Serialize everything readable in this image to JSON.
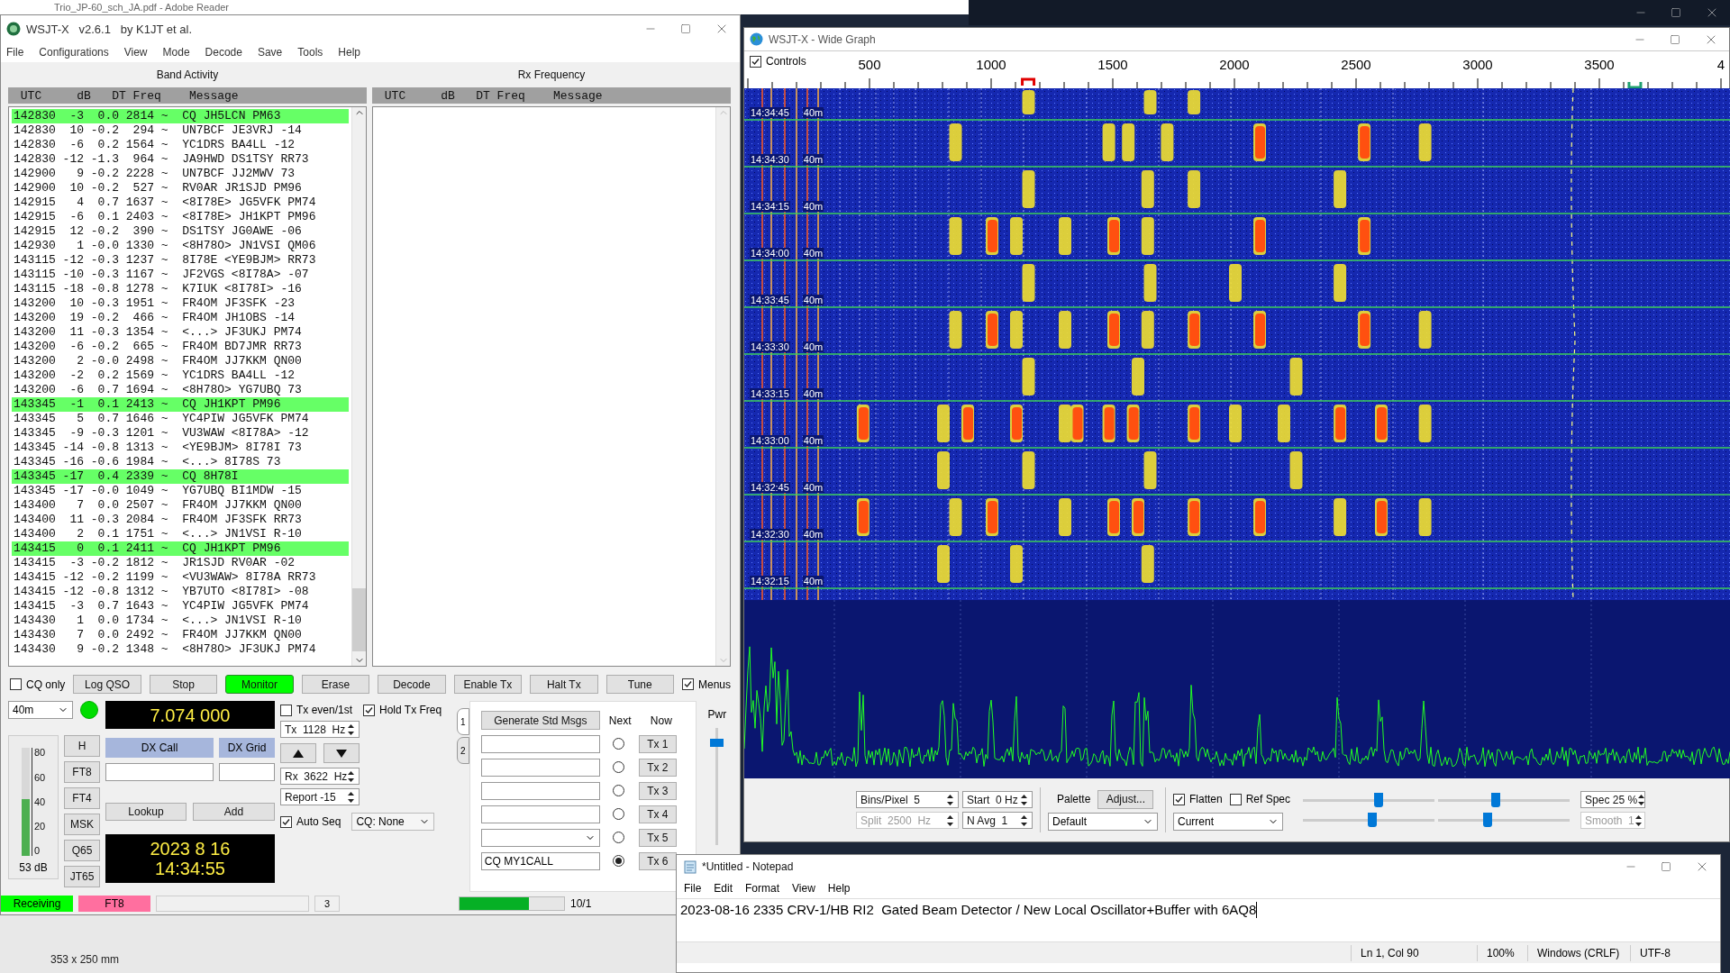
{
  "background": {
    "reader_title": "Trio_JP-60_sch_JA.pdf - Adobe Reader",
    "reader_page_size": "353 x 250 mm"
  },
  "main": {
    "title": "WSJT-X   v2.6.1   by K1JT et al.",
    "menu": [
      "File",
      "Configurations",
      "View",
      "Mode",
      "Decode",
      "Save",
      "Tools",
      "Help"
    ],
    "band_activity": {
      "title": "Band Activity",
      "columns": [
        "UTC",
        "dB",
        "DT",
        "Freq",
        "Message"
      ],
      "rows": [
        {
          "utc": "142830",
          "db": "-3",
          "dt": "0.0",
          "freq": "2814",
          "sep": "~",
          "message": "CQ JH5LCN PM63",
          "highlighted": true
        },
        {
          "utc": "142830",
          "db": "10",
          "dt": "-0.2",
          "freq": "294",
          "sep": "~",
          "message": "UN7BCF JE3VRJ -14",
          "highlighted": false
        },
        {
          "utc": "142830",
          "db": "-6",
          "dt": "0.2",
          "freq": "1564",
          "sep": "~",
          "message": "YC1DRS BA4LL -12",
          "highlighted": false
        },
        {
          "utc": "142830",
          "db": "-12",
          "dt": "-1.3",
          "freq": "964",
          "sep": "~",
          "message": "JA9HWD DS1TSY RR73",
          "highlighted": false
        },
        {
          "utc": "142900",
          "db": "9",
          "dt": "-0.2",
          "freq": "2228",
          "sep": "~",
          "message": "UN7BCF JJ2MWV 73",
          "highlighted": false
        },
        {
          "utc": "142900",
          "db": "10",
          "dt": "-0.2",
          "freq": "527",
          "sep": "~",
          "message": "RV0AR JR1SJD PM96",
          "highlighted": false
        },
        {
          "utc": "142915",
          "db": "4",
          "dt": "0.7",
          "freq": "1637",
          "sep": "~",
          "message": "<8I78E> JG5VFK PM74",
          "highlighted": false
        },
        {
          "utc": "142915",
          "db": "-6",
          "dt": "0.1",
          "freq": "2403",
          "sep": "~",
          "message": "<8I78E> JH1KPT PM96",
          "highlighted": false
        },
        {
          "utc": "142915",
          "db": "12",
          "dt": "-0.2",
          "freq": "390",
          "sep": "~",
          "message": "DS1TSY JG0AWE -06",
          "highlighted": false
        },
        {
          "utc": "142930",
          "db": "1",
          "dt": "-0.0",
          "freq": "1330",
          "sep": "~",
          "message": "<8H78O> JN1VSI QM06",
          "highlighted": false
        },
        {
          "utc": "143115",
          "db": "-12",
          "dt": "-0.3",
          "freq": "1237",
          "sep": "~",
          "message": "8I78E <YE9BJM> RR73",
          "highlighted": false
        },
        {
          "utc": "143115",
          "db": "-10",
          "dt": "-0.3",
          "freq": "1167",
          "sep": "~",
          "message": "JF2VGS <8I78A> -07",
          "highlighted": false
        },
        {
          "utc": "143115",
          "db": "-18",
          "dt": "-0.8",
          "freq": "1278",
          "sep": "~",
          "message": "K7IUK <8I78I> -16",
          "highlighted": false
        },
        {
          "utc": "143200",
          "db": "10",
          "dt": "-0.3",
          "freq": "1951",
          "sep": "~",
          "message": "FR4OM JF3SFK -23",
          "highlighted": false
        },
        {
          "utc": "143200",
          "db": "19",
          "dt": "-0.2",
          "freq": "466",
          "sep": "~",
          "message": "FR4OM JH1OBS -14",
          "highlighted": false
        },
        {
          "utc": "143200",
          "db": "11",
          "dt": "-0.3",
          "freq": "1354",
          "sep": "~",
          "message": "<...> JF3UKJ PM74",
          "highlighted": false
        },
        {
          "utc": "143200",
          "db": "-6",
          "dt": "-0.2",
          "freq": "665",
          "sep": "~",
          "message": "FR4OM BD7JMR RR73",
          "highlighted": false
        },
        {
          "utc": "143200",
          "db": "2",
          "dt": "-0.0",
          "freq": "2498",
          "sep": "~",
          "message": "FR4OM JJ7KKM QN00",
          "highlighted": false
        },
        {
          "utc": "143200",
          "db": "-2",
          "dt": "0.2",
          "freq": "1569",
          "sep": "~",
          "message": "YC1DRS BA4LL -12",
          "highlighted": false
        },
        {
          "utc": "143200",
          "db": "-6",
          "dt": "0.7",
          "freq": "1694",
          "sep": "~",
          "message": "<8H78O> YG7UBQ 73",
          "highlighted": false
        },
        {
          "utc": "143345",
          "db": "-1",
          "dt": "0.1",
          "freq": "2413",
          "sep": "~",
          "message": "CQ JH1KPT PM96",
          "highlighted": true
        },
        {
          "utc": "143345",
          "db": "5",
          "dt": "0.7",
          "freq": "1646",
          "sep": "~",
          "message": "YC4PIW JG5VFK PM74",
          "highlighted": false
        },
        {
          "utc": "143345",
          "db": "-9",
          "dt": "-0.3",
          "freq": "1201",
          "sep": "~",
          "message": "VU3WAW <8I78A> -12",
          "highlighted": false
        },
        {
          "utc": "143345",
          "db": "-14",
          "dt": "-0.8",
          "freq": "1313",
          "sep": "~",
          "message": "<YE9BJM> 8I78I 73",
          "highlighted": false
        },
        {
          "utc": "143345",
          "db": "-16",
          "dt": "-0.6",
          "freq": "1984",
          "sep": "~",
          "message": "<...> 8I78S 73",
          "highlighted": false
        },
        {
          "utc": "143345",
          "db": "-17",
          "dt": "0.4",
          "freq": "2339",
          "sep": "~",
          "message": "CQ 8H78I",
          "highlighted": true
        },
        {
          "utc": "143345",
          "db": "-17",
          "dt": "-0.0",
          "freq": "1049",
          "sep": "~",
          "message": "YG7UBQ BI1MDW -15",
          "highlighted": false
        },
        {
          "utc": "143400",
          "db": "7",
          "dt": "0.0",
          "freq": "2507",
          "sep": "~",
          "message": "FR4OM JJ7KKM QN00",
          "highlighted": false
        },
        {
          "utc": "143400",
          "db": "11",
          "dt": "-0.3",
          "freq": "2084",
          "sep": "~",
          "message": "FR4OM JF3SFK RR73",
          "highlighted": false
        },
        {
          "utc": "143400",
          "db": "2",
          "dt": "0.1",
          "freq": "1751",
          "sep": "~",
          "message": "<...> JN1VSI R-10",
          "highlighted": false
        },
        {
          "utc": "143415",
          "db": "0",
          "dt": "0.1",
          "freq": "2411",
          "sep": "~",
          "message": "CQ JH1KPT PM96",
          "highlighted": true
        },
        {
          "utc": "143415",
          "db": "-3",
          "dt": "-0.2",
          "freq": "1812",
          "sep": "~",
          "message": "JR1SJD RV0AR -02",
          "highlighted": false
        },
        {
          "utc": "143415",
          "db": "-12",
          "dt": "-0.2",
          "freq": "1199",
          "sep": "~",
          "message": "<VU3WAW> 8I78A RR73",
          "highlighted": false
        },
        {
          "utc": "143415",
          "db": "-12",
          "dt": "-0.8",
          "freq": "1312",
          "sep": "~",
          "message": "YB7UTO <8I78I> -08",
          "highlighted": false
        },
        {
          "utc": "143415",
          "db": "-3",
          "dt": "0.7",
          "freq": "1643",
          "sep": "~",
          "message": "YC4PIW JG5VFK PM74",
          "highlighted": false
        },
        {
          "utc": "143430",
          "db": "1",
          "dt": "0.0",
          "freq": "1734",
          "sep": "~",
          "message": "<...> JN1VSI R-10",
          "highlighted": false
        },
        {
          "utc": "143430",
          "db": "7",
          "dt": "0.0",
          "freq": "2492",
          "sep": "~",
          "message": "FR4OM JJ7KKM QN00",
          "highlighted": false
        },
        {
          "utc": "143430",
          "db": "9",
          "dt": "-0.2",
          "freq": "1348",
          "sep": "~",
          "message": "<8H78O> JF3UKJ PM74",
          "highlighted": false
        }
      ]
    },
    "rx_frequency": {
      "title": "Rx Frequency",
      "columns": [
        "UTC",
        "dB",
        "DT",
        "Freq",
        "Message"
      ]
    },
    "buttons": [
      {
        "kind": "checkbox",
        "label": "CQ only",
        "checked": false
      },
      {
        "kind": "button",
        "label": "Log QSO",
        "active": false
      },
      {
        "kind": "button",
        "label": "Stop",
        "active": false
      },
      {
        "kind": "button",
        "label": "Monitor",
        "active": true
      },
      {
        "kind": "button",
        "label": "Erase",
        "active": false
      },
      {
        "kind": "button",
        "label": "Decode",
        "active": false
      },
      {
        "kind": "button",
        "label": "Enable Tx",
        "active": false
      },
      {
        "kind": "button",
        "label": "Halt Tx",
        "active": false
      },
      {
        "kind": "button",
        "label": "Tune",
        "active": false
      },
      {
        "kind": "checkbox",
        "label": "Menus",
        "checked": true
      }
    ],
    "band": "40m",
    "dial_frequency": "7.074 000",
    "meter": {
      "ticks": [
        "80",
        "60",
        "40",
        "20",
        "0"
      ],
      "reading": "53 dB",
      "level": 0.53
    },
    "modes": [
      "H",
      "FT8",
      "FT4",
      "MSK",
      "Q65",
      "JT65"
    ],
    "dx_call_label": "DX Call",
    "dx_grid_label": "DX Grid",
    "lookup": "Lookup",
    "add": "Add",
    "date": "2023 8 16",
    "time": "14:34:55",
    "tx_even": {
      "label": "Tx even/1st",
      "checked": false
    },
    "hold_tx_freq": {
      "label": "Hold Tx Freq",
      "checked": true
    },
    "tx_freq": {
      "prefix": "Tx",
      "value": "1128",
      "unit": "Hz"
    },
    "rx_freq": {
      "prefix": "Rx",
      "value": "3622",
      "unit": "Hz"
    },
    "report": "Report -15",
    "auto_seq": {
      "label": "Auto Seq",
      "checked": true
    },
    "cq_select": "CQ: None",
    "tabs": [
      {
        "label": "1",
        "selected": true
      },
      {
        "label": "2",
        "selected": false
      }
    ],
    "tx_panel": {
      "generate": "Generate Std Msgs",
      "next_label": "Next",
      "now_label": "Now",
      "rows": [
        {
          "kind": "input",
          "selected": false,
          "button": "Tx 1"
        },
        {
          "kind": "input",
          "selected": false,
          "button": "Tx 2"
        },
        {
          "kind": "input",
          "selected": false,
          "button": "Tx 3"
        },
        {
          "kind": "input",
          "selected": false,
          "button": "Tx 4"
        },
        {
          "kind": "combo",
          "selected": false,
          "button": "Tx 5"
        },
        {
          "kind": "input",
          "value": "CQ MY1CALL",
          "selected": true,
          "button": "Tx 6"
        }
      ]
    },
    "power": {
      "label": "Pwr",
      "level": 0.9
    },
    "status": {
      "state": "Receiving",
      "mode": "FT8",
      "count": "3",
      "progress": {
        "level": 0.66
      },
      "cut_text": "10/1"
    }
  },
  "wide_graph": {
    "title": "WSJT-X - Wide Graph",
    "controls_toggle": {
      "label": "Controls",
      "checked": true
    },
    "scale_labels": [
      "500",
      "1000",
      "1500",
      "2000",
      "2500",
      "3000",
      "3500",
      "4"
    ],
    "waterfall_labels": [
      {
        "time": "14:34:45",
        "band": "40m"
      },
      {
        "time": "14:34:30",
        "band": "40m"
      },
      {
        "time": "14:34:15",
        "band": "40m"
      },
      {
        "time": "14:34:00",
        "band": "40m"
      },
      {
        "time": "14:33:45",
        "band": "40m"
      },
      {
        "time": "14:33:30",
        "band": "40m"
      },
      {
        "time": "14:33:15",
        "band": "40m"
      },
      {
        "time": "14:33:00",
        "band": "40m"
      },
      {
        "time": "14:32:45",
        "band": "40m"
      },
      {
        "time": "14:32:30",
        "band": "40m"
      },
      {
        "time": "14:32:15",
        "band": "40m"
      }
    ],
    "spin_row_1": [
      {
        "text": "Bins/Pixel  5",
        "disabled": false
      },
      {
        "text": "Start  0 Hz",
        "disabled": false
      }
    ],
    "spin_row_2": [
      {
        "text": "Split  2500  Hz",
        "disabled": true
      },
      {
        "text": "N Avg  1",
        "disabled": false
      }
    ],
    "palette_label": "Palette",
    "adjust": "Adjust...",
    "palette_select": "Default",
    "flatten": {
      "label": "Flatten",
      "checked": true
    },
    "ref_spec": {
      "label": "Ref Spec",
      "checked": false
    },
    "spectrum_select": "Current",
    "sliders": [
      {
        "level": 0.58
      },
      {
        "level": 0.43
      },
      {
        "level": 0.53
      },
      {
        "level": 0.37
      }
    ],
    "spec": {
      "text": "Spec 25 %",
      "disabled": false
    },
    "smooth": {
      "text": "Smooth  1",
      "disabled": true
    }
  },
  "notepad": {
    "title": "*Untitled - Notepad",
    "menu": [
      "File",
      "Edit",
      "Format",
      "View",
      "Help"
    ],
    "text": "2023-08-16 2335 CRV-1/HB RI2  Gated Beam Detector / New Local Oscillator+Buffer with 6AQ8",
    "status": [
      "Ln 1, Col 90",
      "100%",
      "Windows (CRLF)",
      "UTF-8"
    ]
  }
}
